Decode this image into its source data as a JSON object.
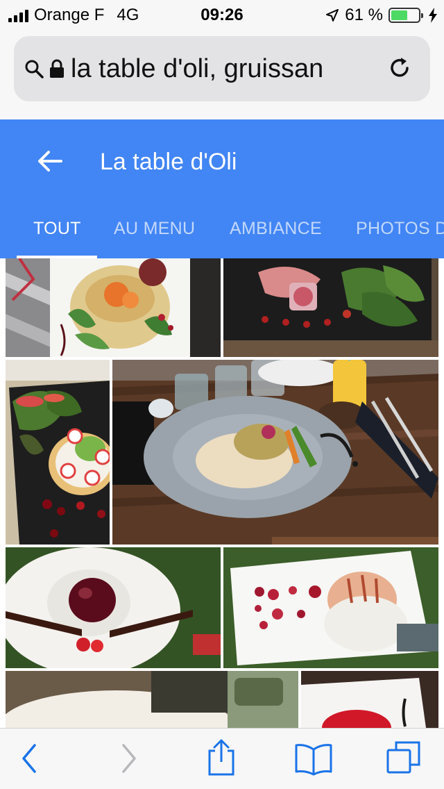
{
  "status_bar": {
    "carrier": "Orange F",
    "network": "4G",
    "time": "09:26",
    "battery": "61 %",
    "battery_fill": 0.61,
    "icons": [
      "signal-icon",
      "location-arrow-icon",
      "battery-icon",
      "charging-bolt-icon"
    ]
  },
  "browser": {
    "url_text": "la table d'oli, gruissan",
    "icons": [
      "search-icon",
      "lock-icon",
      "reload-icon"
    ]
  },
  "header": {
    "title": "La table d'Oli",
    "tabs": [
      {
        "label": "TOUT",
        "active": true
      },
      {
        "label": "AU MENU",
        "active": false
      },
      {
        "label": "AMBIANCE",
        "active": false
      },
      {
        "label": "PHOTOS D",
        "active": false
      }
    ]
  },
  "photos": [
    {
      "name": "photo-salad-crepe-basket"
    },
    {
      "name": "photo-ham-and-greens-slate"
    },
    {
      "name": "photo-toast-radish-slate"
    },
    {
      "name": "photo-risotto-plate-table"
    },
    {
      "name": "photo-red-dome-dessert"
    },
    {
      "name": "photo-meringue-dessert"
    },
    {
      "name": "photo-plate-partial"
    },
    {
      "name": "photo-red-dessert-partial"
    }
  ],
  "toolbar": {
    "items": [
      "back-icon",
      "forward-icon",
      "share-icon",
      "bookmarks-icon",
      "tabs-icon"
    ]
  },
  "colors": {
    "header_blue": "#4285f4",
    "ios_blue": "#1a73e8",
    "battery_green": "#4cd964"
  }
}
